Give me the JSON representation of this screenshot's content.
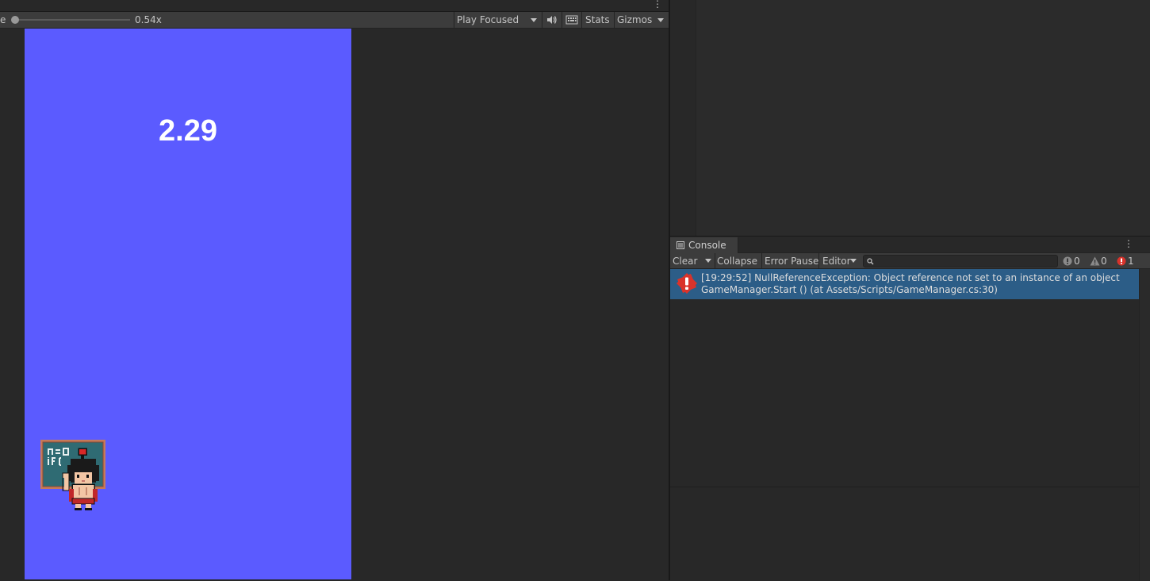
{
  "game_toolbar": {
    "scale_label": "e",
    "scale_value": "0.54x",
    "play_mode": "Play Focused",
    "stats_label": "Stats",
    "gizmos_label": "Gizmos"
  },
  "game": {
    "timer_text": "2.29",
    "background_color": "#5b5bff",
    "sprite_icon": "teacher-at-chalkboard-pixel-sprite"
  },
  "console": {
    "tab_label": "Console",
    "toolbar": {
      "clear_label": "Clear",
      "collapse_label": "Collapse",
      "error_pause_label": "Error Pause",
      "editor_label": "Editor",
      "search_placeholder": "",
      "log_count": "0",
      "warning_count": "0",
      "error_count": "1"
    },
    "entries": [
      {
        "type": "error",
        "line1": "[19:29:52] NullReferenceException: Object reference not set to an instance of an object",
        "line2": "GameManager.Start () (at Assets/Scripts/GameManager.cs:30)"
      }
    ]
  },
  "colors": {
    "panel_bg": "#282828",
    "toolbar_bg": "#3c3c3c",
    "selection_bg": "#2c5d87",
    "error_red": "#d9332b"
  }
}
